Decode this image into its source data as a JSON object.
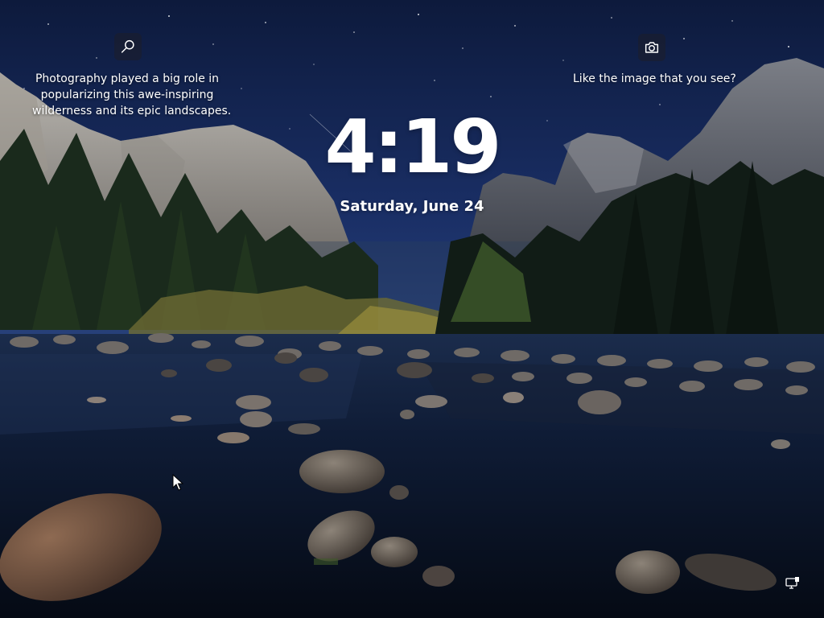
{
  "spotlight": {
    "info_text_line1": "Photography played a big role in",
    "info_text_line2": "popularizing this awe-inspiring",
    "info_text_line3": "wilderness and its epic landscapes.",
    "feedback_text": "Like the image that you see?"
  },
  "clock": {
    "time": "4:19",
    "date": "Saturday, June 24"
  },
  "icons": {
    "info": "search-icon",
    "feedback": "camera-icon",
    "network": "network-icon"
  },
  "colors": {
    "sky_top": "#0f1c3e",
    "water": "#0a1428",
    "text": "#ffffff"
  }
}
